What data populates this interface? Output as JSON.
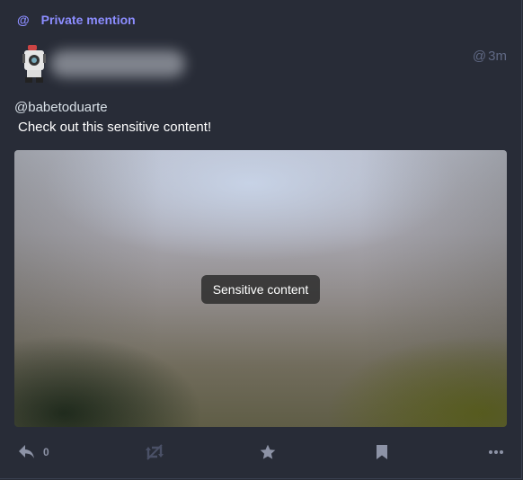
{
  "prepend": {
    "icon": "at-icon",
    "at_symbol": "@",
    "label": "Private mention"
  },
  "account": {
    "avatar_icon": "robot-avatar"
  },
  "meta": {
    "visibility_symbol": "@",
    "time": "3m"
  },
  "content": {
    "mention": "@babetoduarte",
    "text": "Check out this sensitive content!"
  },
  "media": {
    "sensitive_label": "Sensitive content"
  },
  "actions": {
    "reply": {
      "icon": "reply-icon",
      "count": "0"
    },
    "boost": {
      "icon": "boost-disabled-icon"
    },
    "favourite": {
      "icon": "star-icon"
    },
    "bookmark": {
      "icon": "bookmark-icon"
    },
    "more": {
      "icon": "ellipsis-icon"
    }
  },
  "colors": {
    "background": "#282c37",
    "accent": "#8c8dff",
    "muted": "#606984",
    "action": "#8d93a6",
    "text": "#ffffff"
  }
}
